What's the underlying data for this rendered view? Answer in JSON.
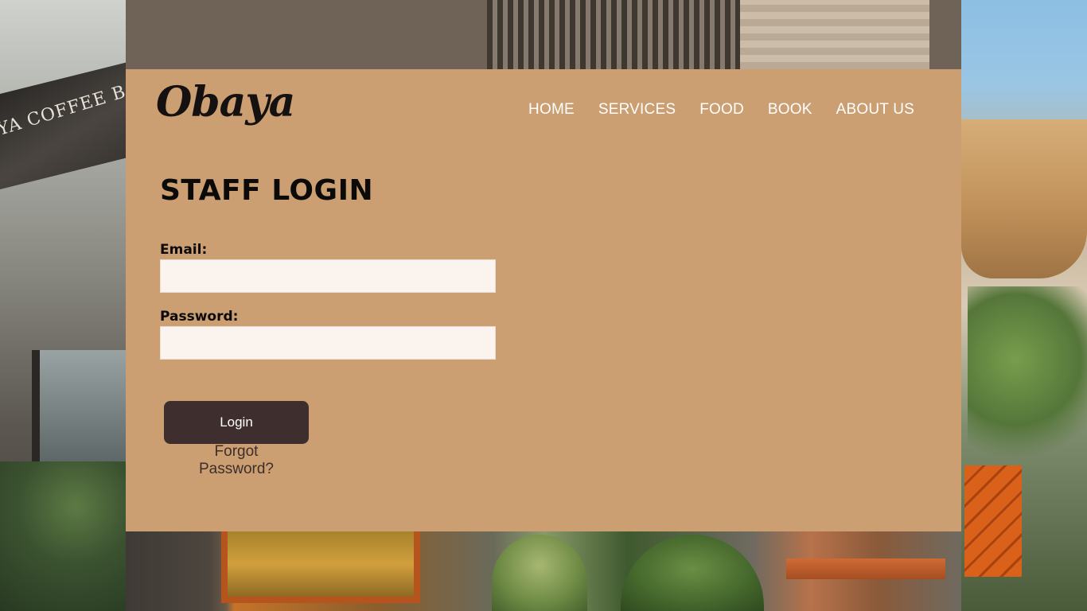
{
  "brand": {
    "logo_text": "Obaya",
    "background_sign_text": "YA COFFEE BAR"
  },
  "nav": {
    "items": [
      {
        "label": "HOME"
      },
      {
        "label": "SERVICES"
      },
      {
        "label": "FOOD"
      },
      {
        "label": "BOOK"
      },
      {
        "label": "ABOUT US"
      }
    ]
  },
  "login": {
    "title": "STAFF LOGIN",
    "email_label": "Email:",
    "email_value": "",
    "password_label": "Password:",
    "password_value": "",
    "submit_label": "Login",
    "forgot_label": "Forgot Password?"
  },
  "colors": {
    "card_background": "#cc9f73",
    "button_background": "#3e2f2e",
    "input_background": "#fbf3ee",
    "nav_text": "#ffffff"
  }
}
